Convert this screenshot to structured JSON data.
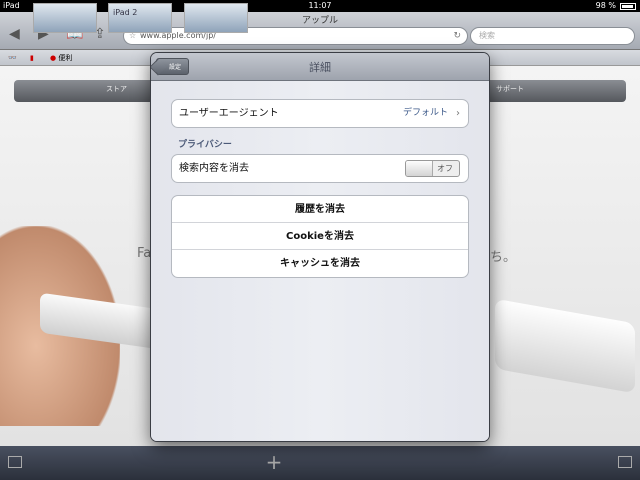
{
  "status": {
    "device": "iPad",
    "time": "11:07",
    "battery": "98 %"
  },
  "toolbar": {
    "page_title": "アップル",
    "url": "www.apple.com/jp/",
    "search_placeholder": "検索"
  },
  "bookmarks": {
    "item": "便利"
  },
  "background": {
    "nav_items": [
      "ストア",
      "サポート"
    ],
    "hero_left": "Fa",
    "hero_right": "ち。"
  },
  "tabs": {
    "ipad2_label": "iPad 2"
  },
  "popover": {
    "back_label": "設定",
    "title": "詳細",
    "user_agent_label": "ユーザーエージェント",
    "user_agent_value": "デフォルト",
    "privacy_header": "プライバシー",
    "clear_search_label": "検索内容を消去",
    "clear_search_toggle": "オフ",
    "clear_history": "履歴を消去",
    "clear_cookies": "Cookieを消去",
    "clear_cache": "キャッシュを消去"
  }
}
